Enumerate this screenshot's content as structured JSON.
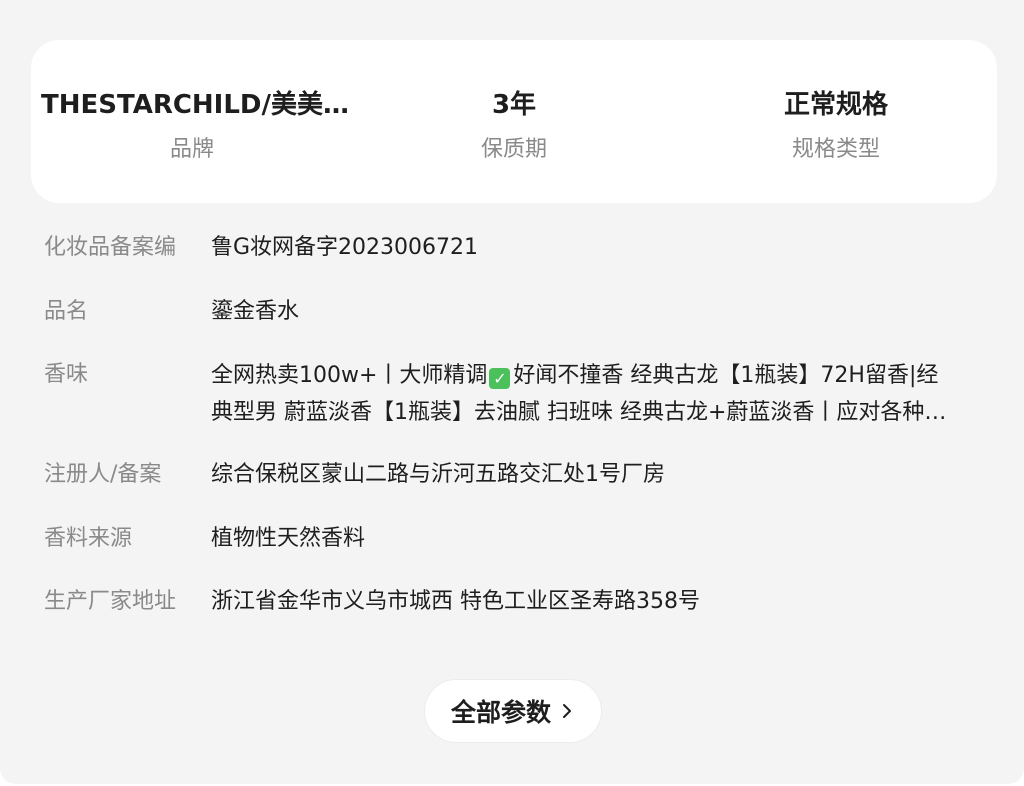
{
  "summary": {
    "items": [
      {
        "value": "THESTARCHILD/美美…",
        "label": "品牌"
      },
      {
        "value": "3年",
        "label": "保质期"
      },
      {
        "value": "正常规格",
        "label": "规格类型"
      }
    ]
  },
  "params": {
    "filing_number": {
      "label": "化妆品备案编",
      "value": "鲁G妆网备字2023006721"
    },
    "product_name": {
      "label": "品名",
      "value": "鎏金香水"
    },
    "scent": {
      "label": "香味",
      "line1_a": "全网热卖100w+丨大师精调",
      "line1_b": "好闻不撞香 经典古龙【1瓶装】72H留香|经",
      "line2": "典型男 蔚蓝淡香【1瓶装】去油腻 扫班味 经典古龙+蔚蓝淡香丨应对各种…"
    },
    "registrant": {
      "label": "注册人/备案",
      "value": "综合保税区蒙山二路与沂河五路交汇处1号厂房"
    },
    "fragrance_source": {
      "label": "香料来源",
      "value": "植物性天然香料"
    },
    "manufacturer_address": {
      "label": "生产厂家地址",
      "value": "浙江省金华市义乌市城西 特色工业区圣寿路358号"
    }
  },
  "footer": {
    "all_params_label": "全部参数",
    "chevron_icon": "chevron-right-icon"
  },
  "colors": {
    "background": "#f4f4f4",
    "card": "#ffffff",
    "primary_text": "#1e1e1e",
    "secondary_text": "#8a8a8a",
    "check_emoji": "#4cc05a"
  }
}
